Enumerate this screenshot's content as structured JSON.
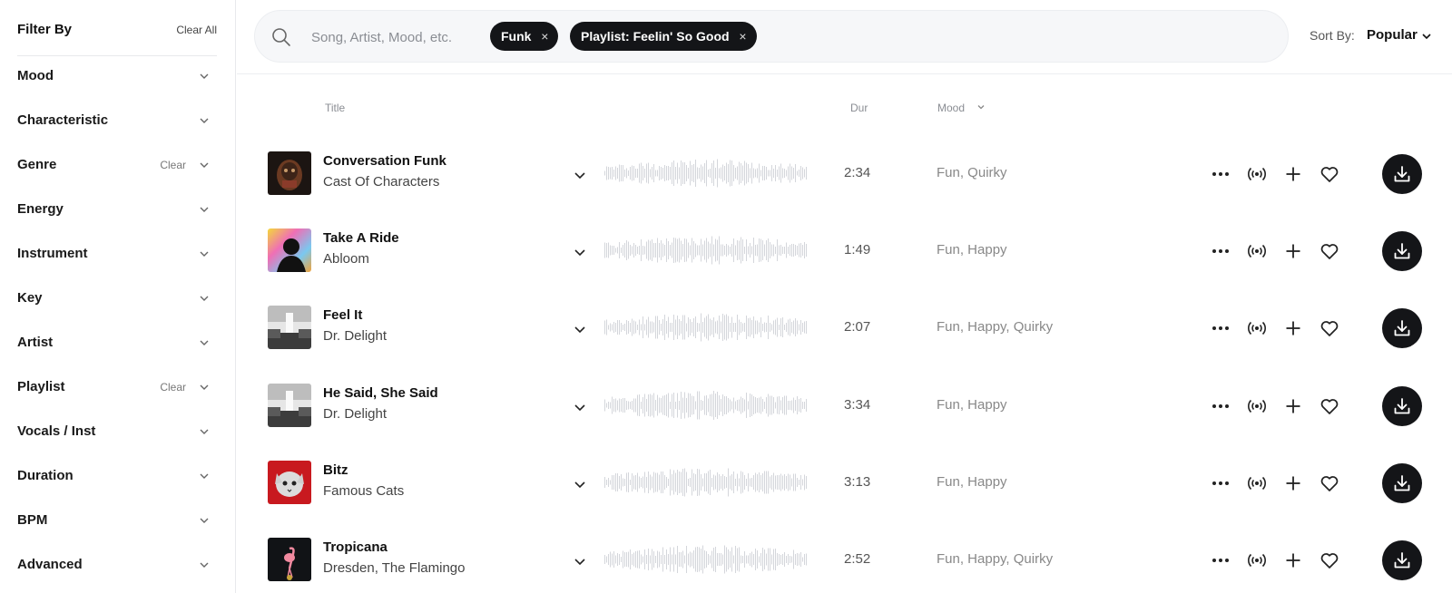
{
  "sidebar": {
    "title": "Filter By",
    "clear_all": "Clear All",
    "facets": [
      {
        "label": "Mood",
        "clear": ""
      },
      {
        "label": "Characteristic",
        "clear": ""
      },
      {
        "label": "Genre",
        "clear": "Clear"
      },
      {
        "label": "Energy",
        "clear": ""
      },
      {
        "label": "Instrument",
        "clear": ""
      },
      {
        "label": "Key",
        "clear": ""
      },
      {
        "label": "Artist",
        "clear": ""
      },
      {
        "label": "Playlist",
        "clear": "Clear"
      },
      {
        "label": "Vocals / Inst",
        "clear": ""
      },
      {
        "label": "Duration",
        "clear": ""
      },
      {
        "label": "BPM",
        "clear": ""
      },
      {
        "label": "Advanced",
        "clear": ""
      }
    ]
  },
  "search": {
    "placeholder": "Song, Artist, Mood, etc.",
    "chips": [
      {
        "label": "Funk",
        "remove": "×"
      },
      {
        "label": "Playlist: Feelin' So Good",
        "remove": "×"
      }
    ]
  },
  "sort": {
    "label": "Sort By:",
    "value": "Popular"
  },
  "columns": {
    "title": "Title",
    "duration": "Dur",
    "mood": "Mood"
  },
  "tracks": [
    {
      "title": "Conversation Funk",
      "artist": "Cast Of Characters",
      "duration": "2:34",
      "mood": "Fun, Quirky"
    },
    {
      "title": "Take A Ride",
      "artist": "Abloom",
      "duration": "1:49",
      "mood": "Fun, Happy"
    },
    {
      "title": "Feel It",
      "artist": "Dr. Delight",
      "duration": "2:07",
      "mood": "Fun, Happy, Quirky"
    },
    {
      "title": "He Said, She Said",
      "artist": "Dr. Delight",
      "duration": "3:34",
      "mood": "Fun, Happy"
    },
    {
      "title": "Bitz",
      "artist": "Famous Cats",
      "duration": "3:13",
      "mood": "Fun, Happy"
    },
    {
      "title": "Tropicana",
      "artist": "Dresden, The Flamingo",
      "duration": "2:52",
      "mood": "Fun, Happy, Quirky"
    }
  ],
  "icons": {
    "search": "search-icon",
    "chevron": "chevron-down-icon",
    "more": "more-icon",
    "broadcast": "broadcast-icon",
    "add": "plus-icon",
    "favorite": "heart-icon",
    "download": "download-icon"
  },
  "colors": {
    "chip_bg": "#141518",
    "download_bg": "#141518",
    "waveform": "#d4d6db",
    "search_bg": "#f6f7f9"
  }
}
